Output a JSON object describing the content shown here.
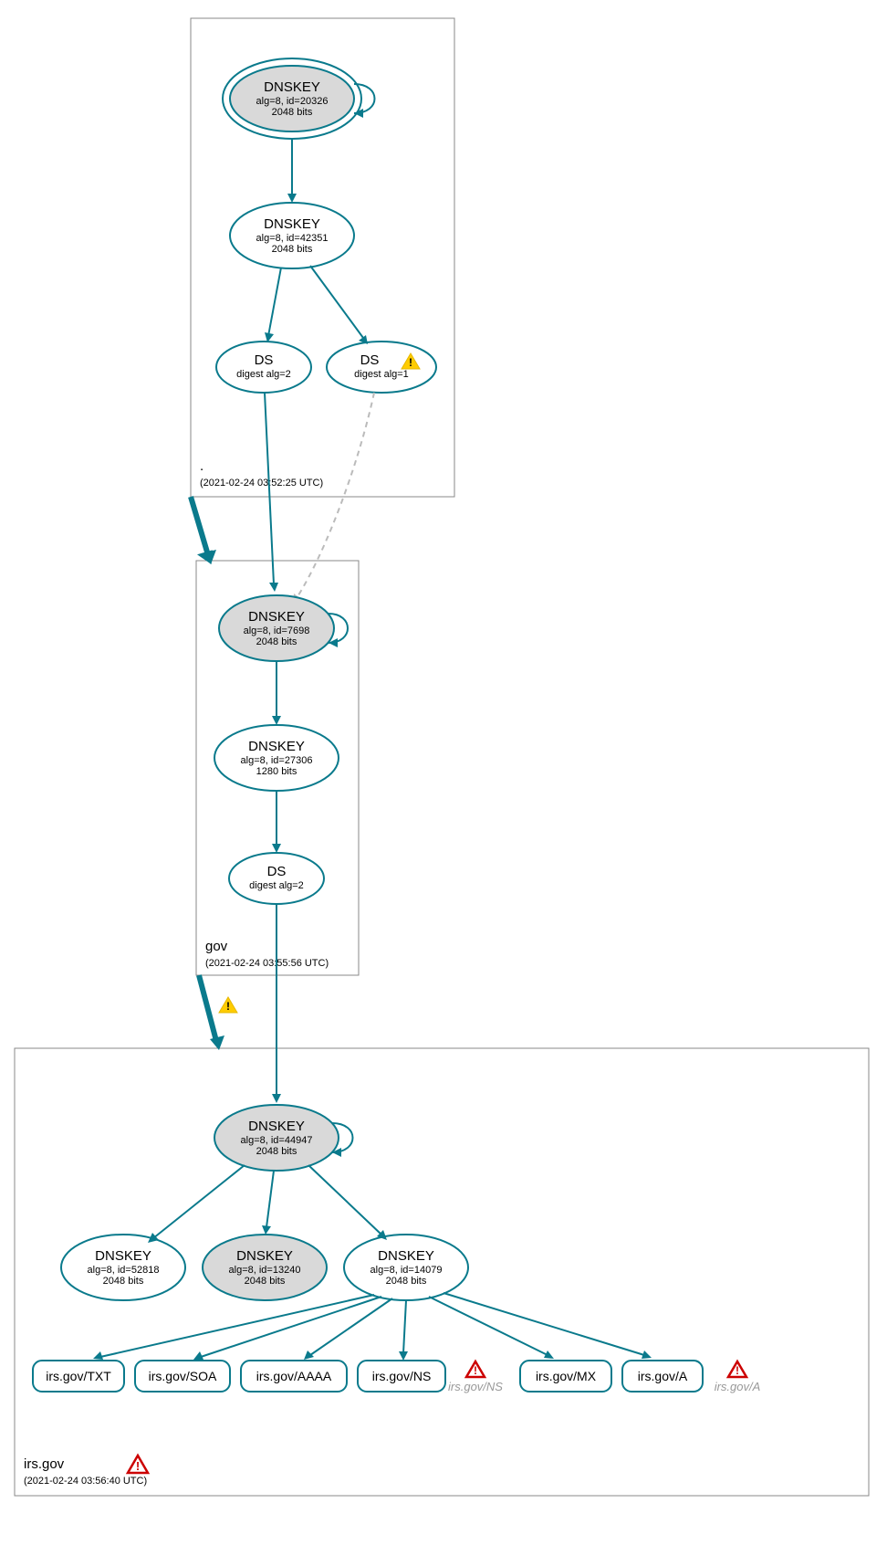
{
  "zones": {
    "root": {
      "label": ".",
      "timestamp": "(2021-02-24 03:52:25 UTC)"
    },
    "gov": {
      "label": "gov",
      "timestamp": "(2021-02-24 03:55:56 UTC)"
    },
    "irs": {
      "label": "irs.gov",
      "timestamp": "(2021-02-24 03:56:40 UTC)"
    }
  },
  "nodes": {
    "root_ksk": {
      "title": "DNSKEY",
      "line2": "alg=8, id=20326",
      "line3": "2048 bits"
    },
    "root_zsk": {
      "title": "DNSKEY",
      "line2": "alg=8, id=42351",
      "line3": "2048 bits"
    },
    "root_ds1": {
      "title": "DS",
      "line2": "digest alg=2"
    },
    "root_ds2": {
      "title": "DS",
      "line2": "digest alg=1"
    },
    "gov_ksk": {
      "title": "DNSKEY",
      "line2": "alg=8, id=7698",
      "line3": "2048 bits"
    },
    "gov_zsk": {
      "title": "DNSKEY",
      "line2": "alg=8, id=27306",
      "line3": "1280 bits"
    },
    "gov_ds": {
      "title": "DS",
      "line2": "digest alg=2"
    },
    "irs_ksk": {
      "title": "DNSKEY",
      "line2": "alg=8, id=44947",
      "line3": "2048 bits"
    },
    "irs_k1": {
      "title": "DNSKEY",
      "line2": "alg=8, id=52818",
      "line3": "2048 bits"
    },
    "irs_k2": {
      "title": "DNSKEY",
      "line2": "alg=8, id=13240",
      "line3": "2048 bits"
    },
    "irs_k3": {
      "title": "DNSKEY",
      "line2": "alg=8, id=14079",
      "line3": "2048 bits"
    }
  },
  "rr": {
    "txt": "irs.gov/TXT",
    "soa": "irs.gov/SOA",
    "aaaa": "irs.gov/AAAA",
    "ns": "irs.gov/NS",
    "ns_ghost": "irs.gov/NS",
    "mx": "irs.gov/MX",
    "a": "irs.gov/A",
    "a_ghost": "irs.gov/A"
  },
  "colors": {
    "stroke": "#0a7a8c"
  }
}
